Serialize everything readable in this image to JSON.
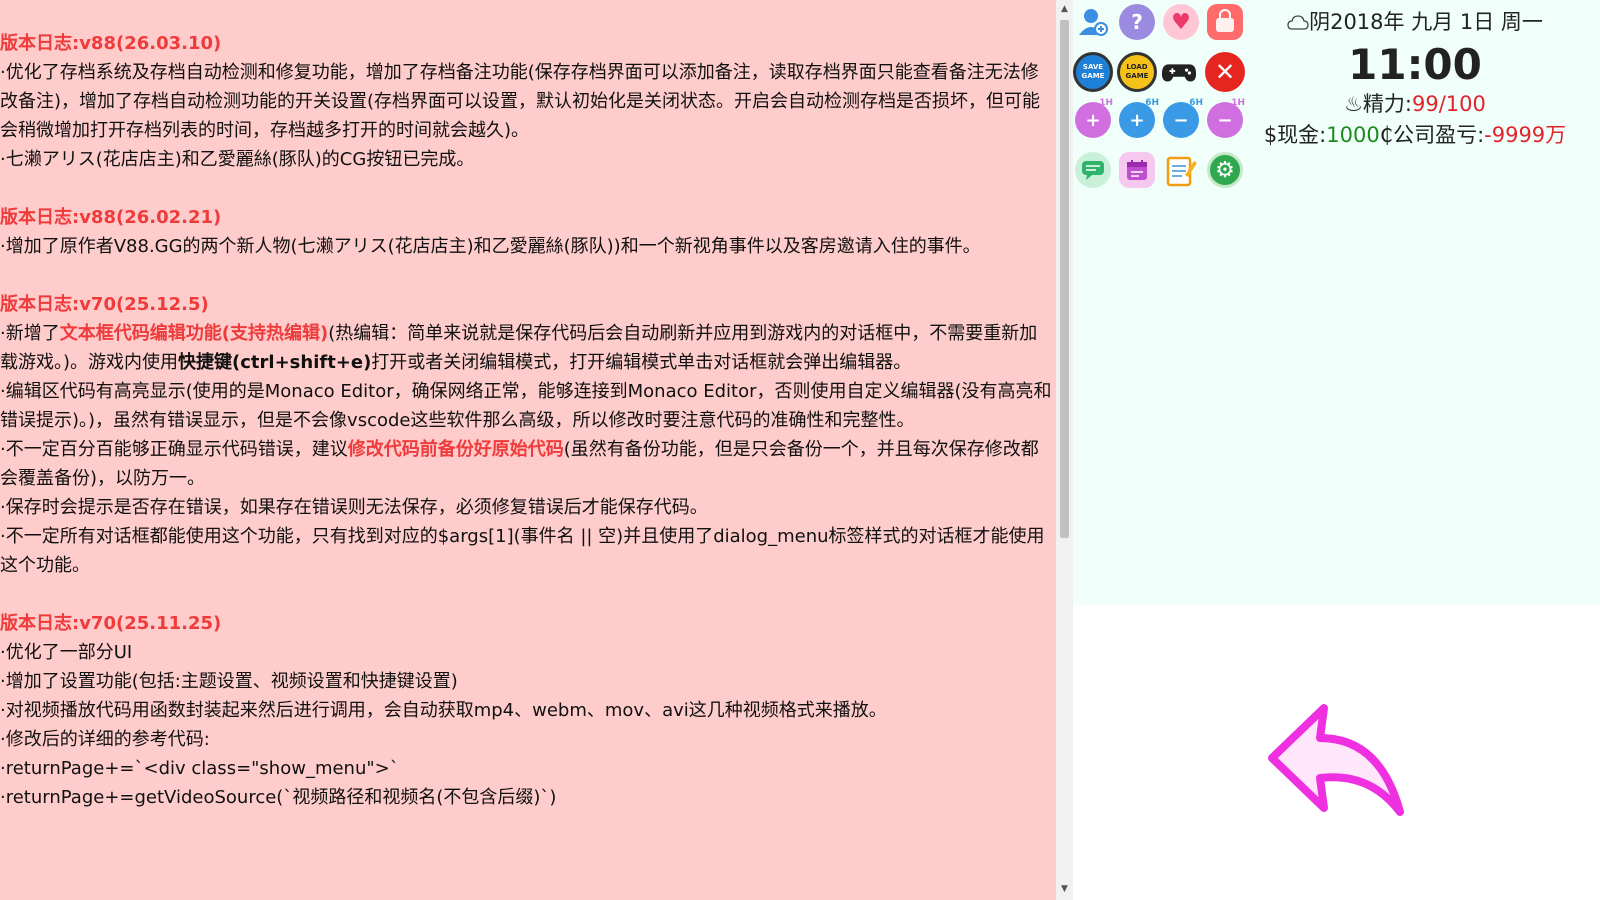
{
  "changelog": [
    {
      "title": "版本日志:v88(26.03.10)",
      "lines": [
        "·优化了存档系统及存档自动检测和修复功能，增加了存档备注功能(保存存档界面可以添加备注，读取存档界面只能查看备注无法修改备注)，增加了存档自动检测功能的开关设置(存档界面可以设置，默认初始化是关闭状态。开启会自动检测存档是否损坏，但可能会稍微增加打开存档列表的时间，存档越多打开的时间就会越久)。",
        "·七濑アリス(花店店主)和乙愛麗絲(豚队)的CG按钮已完成。"
      ]
    },
    {
      "title": "版本日志:v88(26.02.21)",
      "lines": [
        "·增加了原作者V88.GG的两个新人物(七濑アリス(花店店主)和乙愛麗絲(豚队))和一个新视角事件以及客房邀请入住的事件。"
      ]
    },
    {
      "title": "版本日志:v70(25.12.5)",
      "line1_a": "·新增了",
      "line1_red": "文本框代码编辑功能(支持热编辑)",
      "line1_b": "(热编辑：简单来说就是保存代码后会自动刷新并应用到游戏内的对话框中，不需要重新加载游戏。)。游戏内使用",
      "line1_bold": "快捷键(ctrl+shift+e)",
      "line1_c": "打开或者关闭编辑模式，打开编辑模式单击对话框就会弹出编辑器。",
      "line2": "·编辑区代码有高亮显示(使用的是Monaco Editor，确保网络正常，能够连接到Monaco Editor，否则使用自定义编辑器(没有高亮和错误提示)。)，虽然有错误显示，但是不会像vscode这些软件那么高级，所以修改时要注意代码的准确性和完整性。",
      "line3_a": "·不一定百分百能够正确显示代码错误，建议",
      "line3_red": "修改代码前备份好原始代码",
      "line3_b": "(虽然有备份功能，但是只会备份一个，并且每次保存修改都会覆盖备份)，以防万一。",
      "line4": "·保存时会提示是否存在错误，如果存在错误则无法保存，必须修复错误后才能保存代码。",
      "line5": "·不一定所有对话框都能使用这个功能，只有找到对应的$args[1](事件名 || 空)并且使用了dialog_menu标签样式的对话框才能使用这个功能。"
    },
    {
      "title": "版本日志:v70(25.11.25)",
      "lines": [
        "·优化了一部分UI",
        "·增加了设置功能(包括:主题设置、视频设置和快捷键设置)",
        "·对视频播放代码用函数封装起来然后进行调用，会自动获取mp4、webm、mov、avi这几种视频格式来播放。",
        "·修改后的详细的参考代码:",
        "·returnPage+=`<div class=\"show_menu\">`",
        "·returnPage+=getVideoSource(`视频路径和视频名(不包含后缀)`)"
      ]
    }
  ],
  "icons": {
    "row1": [
      "user-add-icon",
      "help-icon",
      "heart-icon",
      "shopping-bag-icon"
    ],
    "row2": [
      "save-game-icon",
      "load-game-icon",
      "gamepad-icon",
      "close-icon"
    ],
    "row3": [
      "wait-1h-icon",
      "wait-6h-icon",
      "wait-6h-back-icon",
      "wait-1h-back-icon"
    ],
    "row4": [
      "chat-icon",
      "calendar-icon",
      "notes-icon",
      "settings-icon"
    ],
    "save_label": "SAVE GAME",
    "load_label": "LOAD GAME",
    "h1_label": "1H",
    "h6_label": "6H"
  },
  "status": {
    "weather_icon": "cloud-icon",
    "date": "阴2018年 九月 1日 周一",
    "time": "11:00",
    "energy_label": "♨精力:",
    "energy_value": "99/100",
    "cash_label": "$现金:",
    "cash_value": "1000",
    "company_label": "₵公司盈亏:",
    "company_value": "-9999万"
  },
  "colors": {
    "log_bg": "#ffcccc",
    "title_red": "#ef3b3b",
    "panel_bg": "#f0fff9",
    "arrow_magenta": "#ee30e0"
  }
}
